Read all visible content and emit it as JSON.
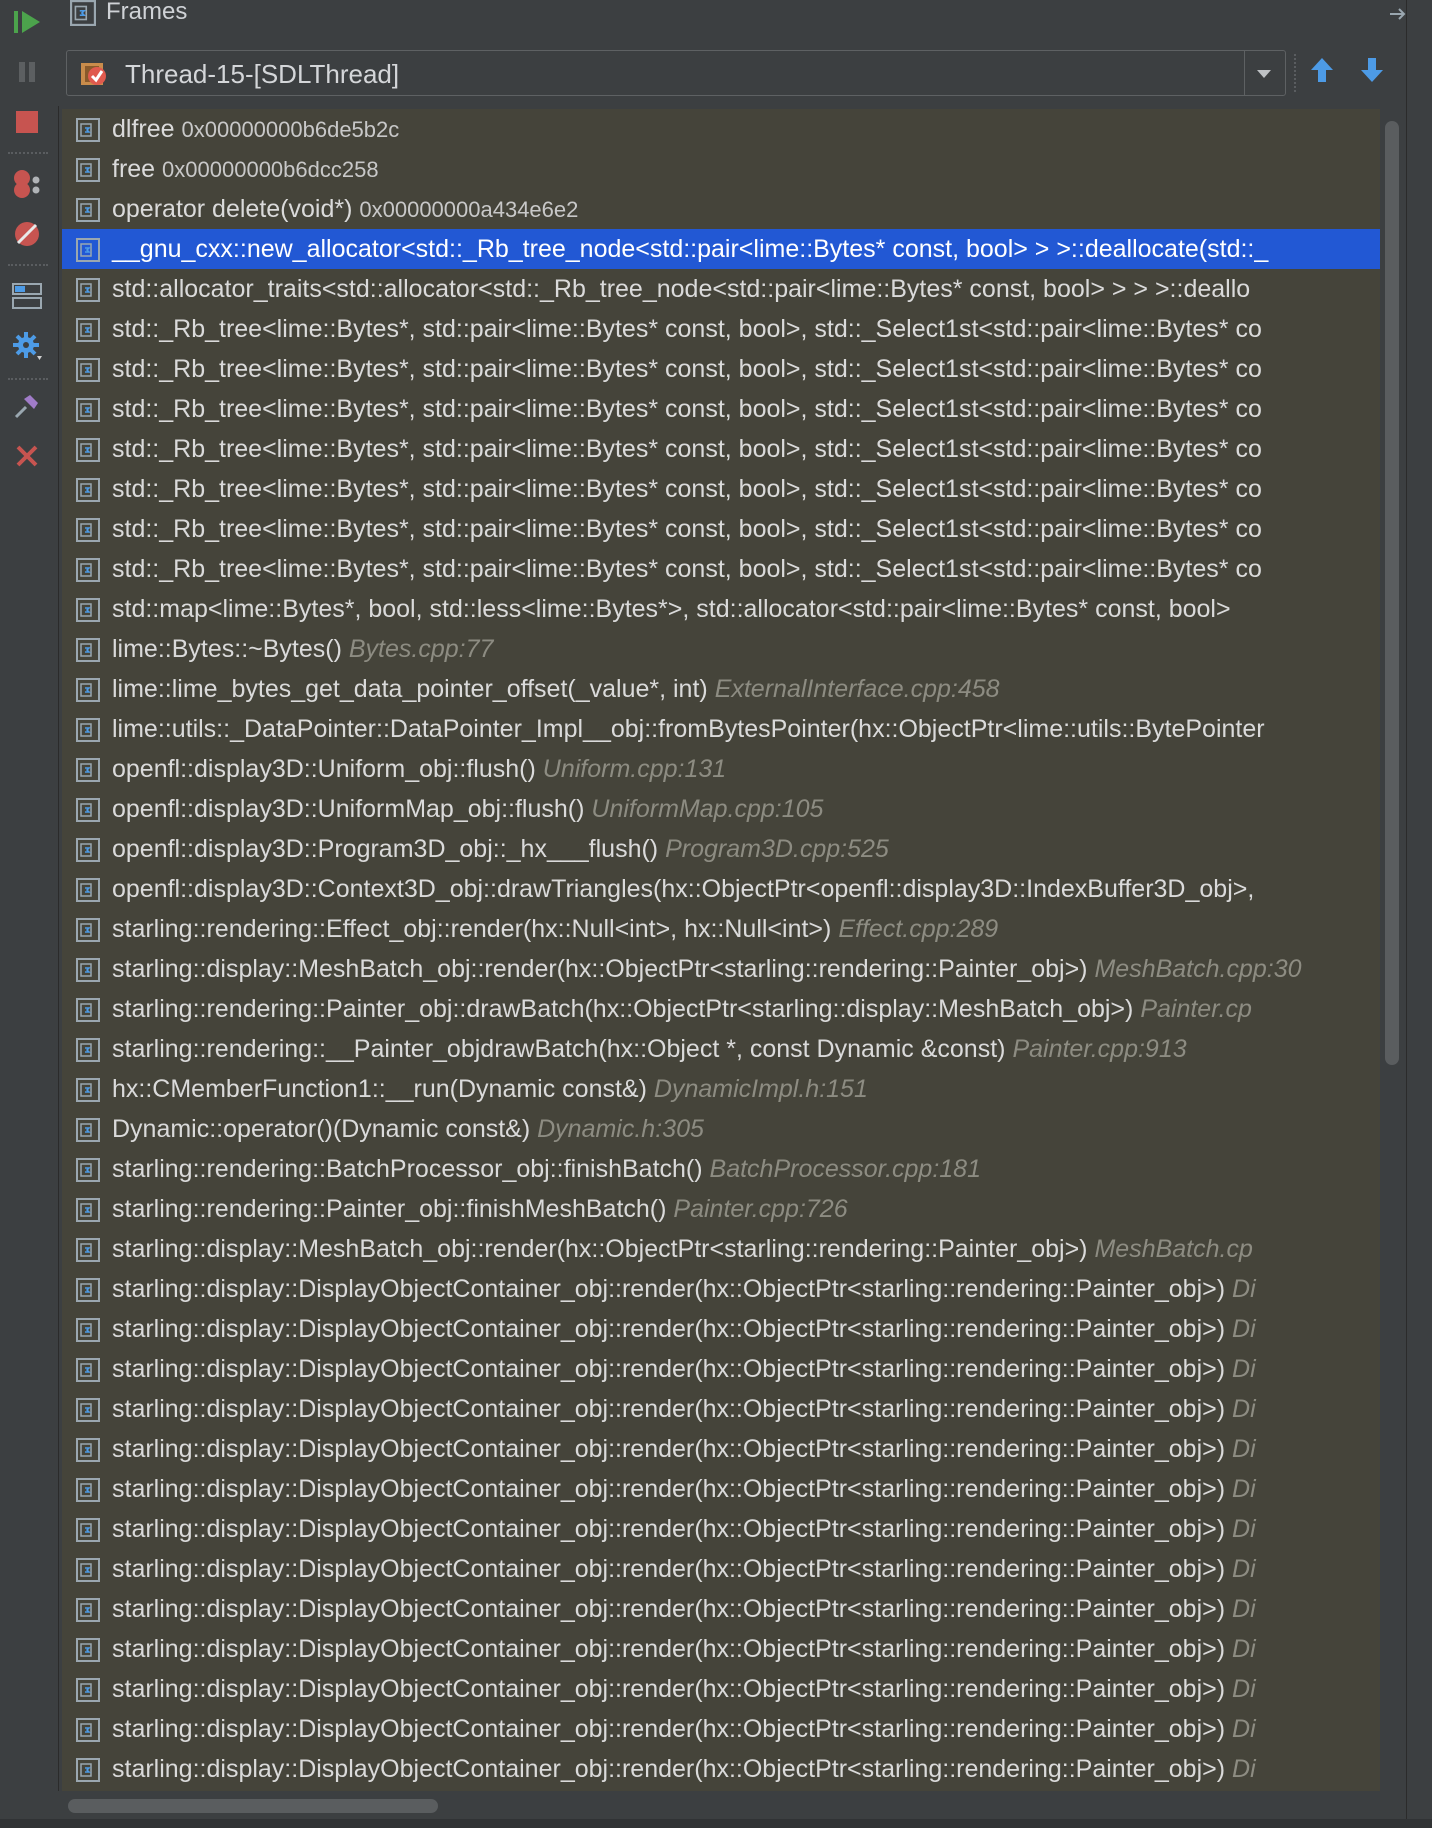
{
  "panel": {
    "title": "Frames"
  },
  "thread_selector": {
    "selected": "Thread-15-[SDLThread]"
  },
  "colors": {
    "list_background": "#45443a",
    "selection": "#2258d4",
    "location_text": "#8d8c82",
    "resume_green": "#4ca34c",
    "stop_red": "#c75450",
    "nav_blue": "#4d9be6"
  },
  "toolbar": {
    "buttons": [
      "resume-icon",
      "pause-icon",
      "stop-icon",
      "view-breakpoints-icon",
      "mute-breakpoints-icon",
      "restore-layout-icon",
      "settings-icon",
      "pin-icon",
      "close-icon"
    ]
  },
  "frames": [
    {
      "name": "dlfree",
      "address": "0x00000000b6de5b2c",
      "location": ""
    },
    {
      "name": "free",
      "address": "0x00000000b6dcc258",
      "location": ""
    },
    {
      "name": "operator delete(void*)",
      "address": "0x00000000a434e6e2",
      "location": ""
    },
    {
      "name": "__gnu_cxx::new_allocator<std::_Rb_tree_node<std::pair<lime::Bytes* const, bool> > >::deallocate(std::_",
      "address": "",
      "location": "",
      "selected": true
    },
    {
      "name": "std::allocator_traits<std::allocator<std::_Rb_tree_node<std::pair<lime::Bytes* const, bool> > > >::deallo",
      "address": "",
      "location": ""
    },
    {
      "name": "std::_Rb_tree<lime::Bytes*, std::pair<lime::Bytes* const, bool>, std::_Select1st<std::pair<lime::Bytes* co",
      "address": "",
      "location": ""
    },
    {
      "name": "std::_Rb_tree<lime::Bytes*, std::pair<lime::Bytes* const, bool>, std::_Select1st<std::pair<lime::Bytes* co",
      "address": "",
      "location": ""
    },
    {
      "name": "std::_Rb_tree<lime::Bytes*, std::pair<lime::Bytes* const, bool>, std::_Select1st<std::pair<lime::Bytes* co",
      "address": "",
      "location": ""
    },
    {
      "name": "std::_Rb_tree<lime::Bytes*, std::pair<lime::Bytes* const, bool>, std::_Select1st<std::pair<lime::Bytes* co",
      "address": "",
      "location": ""
    },
    {
      "name": "std::_Rb_tree<lime::Bytes*, std::pair<lime::Bytes* const, bool>, std::_Select1st<std::pair<lime::Bytes* co",
      "address": "",
      "location": ""
    },
    {
      "name": "std::_Rb_tree<lime::Bytes*, std::pair<lime::Bytes* const, bool>, std::_Select1st<std::pair<lime::Bytes* co",
      "address": "",
      "location": ""
    },
    {
      "name": "std::_Rb_tree<lime::Bytes*, std::pair<lime::Bytes* const, bool>, std::_Select1st<std::pair<lime::Bytes* co",
      "address": "",
      "location": ""
    },
    {
      "name": "std::map<lime::Bytes*, bool, std::less<lime::Bytes*>, std::allocator<std::pair<lime::Bytes* const, bool>",
      "address": "",
      "location": ""
    },
    {
      "name": "lime::Bytes::~Bytes()",
      "address": "",
      "location": "Bytes.cpp:77"
    },
    {
      "name": "lime::lime_bytes_get_data_pointer_offset(_value*, int)",
      "address": "",
      "location": "ExternalInterface.cpp:458"
    },
    {
      "name": "lime::utils::_DataPointer::DataPointer_Impl__obj::fromBytesPointer(hx::ObjectPtr<lime::utils::BytePointer",
      "address": "",
      "location": ""
    },
    {
      "name": "openfl::display3D::Uniform_obj::flush()",
      "address": "",
      "location": "Uniform.cpp:131"
    },
    {
      "name": "openfl::display3D::UniformMap_obj::flush()",
      "address": "",
      "location": "UniformMap.cpp:105"
    },
    {
      "name": "openfl::display3D::Program3D_obj::_hx___flush()",
      "address": "",
      "location": "Program3D.cpp:525"
    },
    {
      "name": "openfl::display3D::Context3D_obj::drawTriangles(hx::ObjectPtr<openfl::display3D::IndexBuffer3D_obj>,",
      "address": "",
      "location": ""
    },
    {
      "name": "starling::rendering::Effect_obj::render(hx::Null<int>, hx::Null<int>)",
      "address": "",
      "location": "Effect.cpp:289"
    },
    {
      "name": "starling::display::MeshBatch_obj::render(hx::ObjectPtr<starling::rendering::Painter_obj>)",
      "address": "",
      "location": "MeshBatch.cpp:30"
    },
    {
      "name": "starling::rendering::Painter_obj::drawBatch(hx::ObjectPtr<starling::display::MeshBatch_obj>)",
      "address": "",
      "location": "Painter.cp"
    },
    {
      "name": "starling::rendering::__Painter_objdrawBatch(hx::Object *, const Dynamic &const)",
      "address": "",
      "location": "Painter.cpp:913"
    },
    {
      "name": "hx::CMemberFunction1::__run(Dynamic const&)",
      "address": "",
      "location": "DynamicImpl.h:151"
    },
    {
      "name": "Dynamic::operator()(Dynamic const&)",
      "address": "",
      "location": "Dynamic.h:305"
    },
    {
      "name": "starling::rendering::BatchProcessor_obj::finishBatch()",
      "address": "",
      "location": "BatchProcessor.cpp:181"
    },
    {
      "name": "starling::rendering::Painter_obj::finishMeshBatch()",
      "address": "",
      "location": "Painter.cpp:726"
    },
    {
      "name": "starling::display::MeshBatch_obj::render(hx::ObjectPtr<starling::rendering::Painter_obj>)",
      "address": "",
      "location": "MeshBatch.cp"
    },
    {
      "name": "starling::display::DisplayObjectContainer_obj::render(hx::ObjectPtr<starling::rendering::Painter_obj>)",
      "address": "",
      "location": "Di"
    },
    {
      "name": "starling::display::DisplayObjectContainer_obj::render(hx::ObjectPtr<starling::rendering::Painter_obj>)",
      "address": "",
      "location": "Di"
    },
    {
      "name": "starling::display::DisplayObjectContainer_obj::render(hx::ObjectPtr<starling::rendering::Painter_obj>)",
      "address": "",
      "location": "Di"
    },
    {
      "name": "starling::display::DisplayObjectContainer_obj::render(hx::ObjectPtr<starling::rendering::Painter_obj>)",
      "address": "",
      "location": "Di"
    },
    {
      "name": "starling::display::DisplayObjectContainer_obj::render(hx::ObjectPtr<starling::rendering::Painter_obj>)",
      "address": "",
      "location": "Di"
    },
    {
      "name": "starling::display::DisplayObjectContainer_obj::render(hx::ObjectPtr<starling::rendering::Painter_obj>)",
      "address": "",
      "location": "Di"
    },
    {
      "name": "starling::display::DisplayObjectContainer_obj::render(hx::ObjectPtr<starling::rendering::Painter_obj>)",
      "address": "",
      "location": "Di"
    },
    {
      "name": "starling::display::DisplayObjectContainer_obj::render(hx::ObjectPtr<starling::rendering::Painter_obj>)",
      "address": "",
      "location": "Di"
    },
    {
      "name": "starling::display::DisplayObjectContainer_obj::render(hx::ObjectPtr<starling::rendering::Painter_obj>)",
      "address": "",
      "location": "Di"
    },
    {
      "name": "starling::display::DisplayObjectContainer_obj::render(hx::ObjectPtr<starling::rendering::Painter_obj>)",
      "address": "",
      "location": "Di"
    },
    {
      "name": "starling::display::DisplayObjectContainer_obj::render(hx::ObjectPtr<starling::rendering::Painter_obj>)",
      "address": "",
      "location": "Di"
    },
    {
      "name": "starling::display::DisplayObjectContainer_obj::render(hx::ObjectPtr<starling::rendering::Painter_obj>)",
      "address": "",
      "location": "Di"
    },
    {
      "name": "starling::display::DisplayObjectContainer_obj::render(hx::ObjectPtr<starling::rendering::Painter_obj>)",
      "address": "",
      "location": "Di"
    }
  ]
}
